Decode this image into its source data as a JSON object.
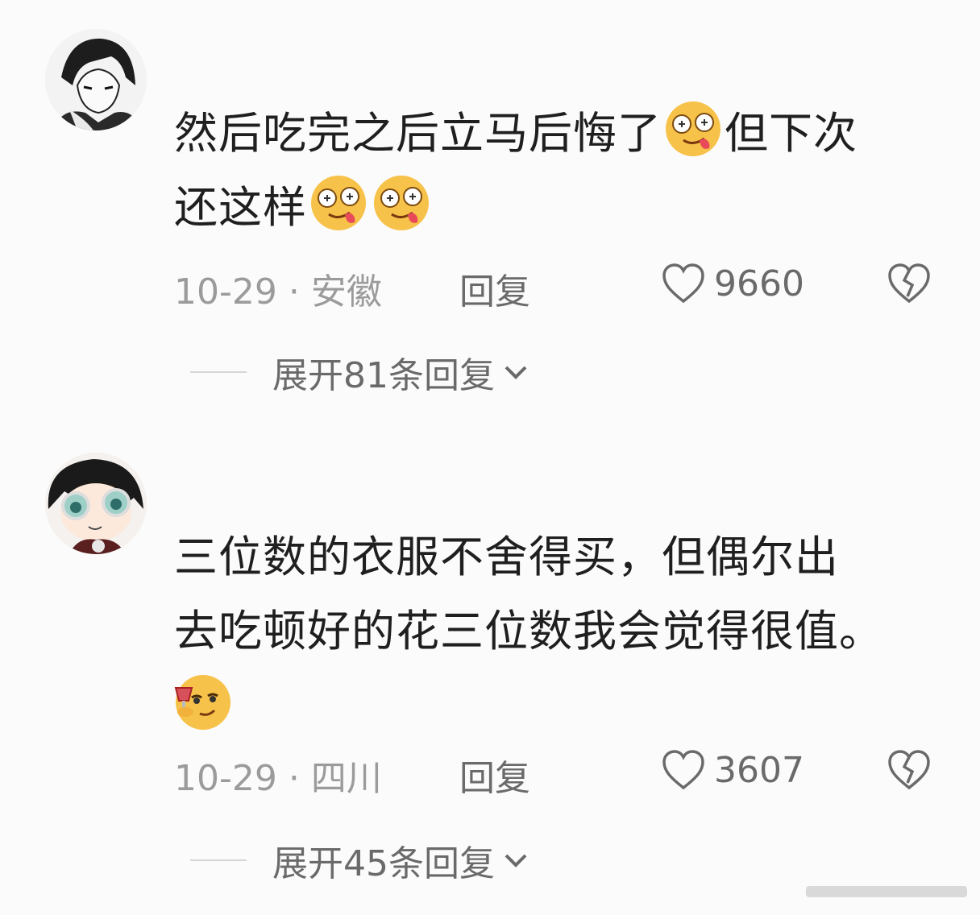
{
  "comments": [
    {
      "text_lines": [
        "然后吃完之后立马后悔了",
        "但下次",
        "还这样"
      ],
      "date": "10-29",
      "location": "安徽",
      "reply_label": "回复",
      "likes": "9660",
      "expand_label": "展开81条回复",
      "emoji": "drooling-money-face"
    },
    {
      "text_lines": [
        "三位数的衣服不舍得买，但偶尔出",
        "去吃顿好的花三位数我会觉得很值。"
      ],
      "date": "10-29",
      "location": "四川",
      "reply_label": "回复",
      "likes": "3607",
      "expand_label": "展开45条回复",
      "emoji": "cheers-smirk-face"
    }
  ],
  "separator": "·",
  "icons": [
    "heart-icon",
    "broken-heart-icon",
    "chevron-down-icon"
  ]
}
